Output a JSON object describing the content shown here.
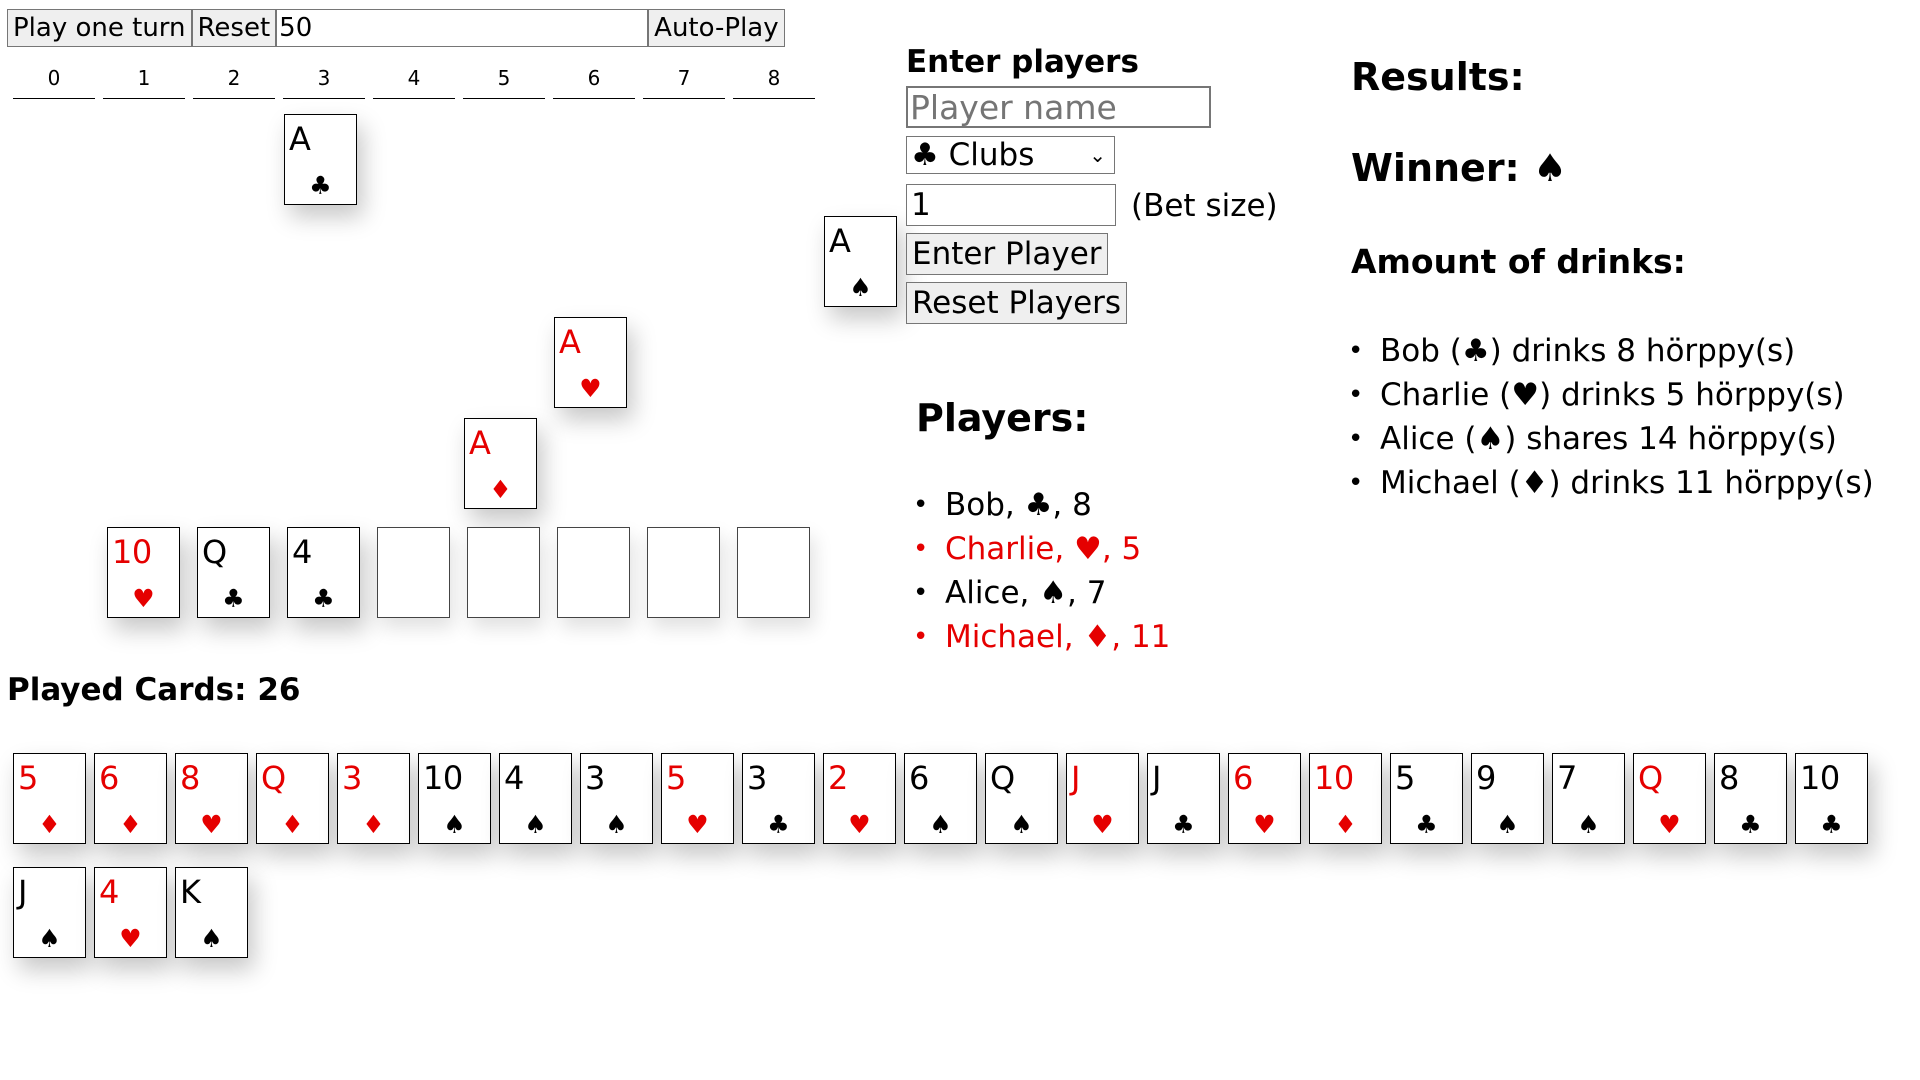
{
  "controls": {
    "play_one_turn": "Play one turn",
    "reset": "Reset",
    "turns_value": "50",
    "auto_play": "Auto-Play"
  },
  "columns": [
    "0",
    "1",
    "2",
    "3",
    "4",
    "5",
    "6",
    "7",
    "8"
  ],
  "board": {
    "aces": [
      {
        "rank": "A",
        "suit": "♣",
        "color": "black",
        "column": "3"
      },
      {
        "rank": "A",
        "suit": "♠",
        "color": "black",
        "column": "finish"
      },
      {
        "rank": "A",
        "suit": "♥",
        "color": "red",
        "column": "6"
      },
      {
        "rank": "A",
        "suit": "♦",
        "color": "red",
        "column": "5"
      }
    ],
    "bottom_row": [
      {
        "rank": "10",
        "suit": "♥",
        "color": "red"
      },
      {
        "rank": "Q",
        "suit": "♣",
        "color": "black"
      },
      {
        "rank": "4",
        "suit": "♣",
        "color": "black"
      },
      {
        "rank": "",
        "suit": "",
        "color": "black"
      },
      {
        "rank": "",
        "suit": "",
        "color": "black"
      },
      {
        "rank": "",
        "suit": "",
        "color": "black"
      },
      {
        "rank": "",
        "suit": "",
        "color": "black"
      },
      {
        "rank": "",
        "suit": "",
        "color": "black"
      }
    ]
  },
  "played": {
    "label": "Played Cards: 26",
    "cards": [
      {
        "rank": "5",
        "suit": "♦",
        "color": "red"
      },
      {
        "rank": "6",
        "suit": "♦",
        "color": "red"
      },
      {
        "rank": "8",
        "suit": "♥",
        "color": "red"
      },
      {
        "rank": "Q",
        "suit": "♦",
        "color": "red"
      },
      {
        "rank": "3",
        "suit": "♦",
        "color": "red"
      },
      {
        "rank": "10",
        "suit": "♠",
        "color": "black"
      },
      {
        "rank": "4",
        "suit": "♠",
        "color": "black"
      },
      {
        "rank": "3",
        "suit": "♠",
        "color": "black"
      },
      {
        "rank": "5",
        "suit": "♥",
        "color": "red"
      },
      {
        "rank": "3",
        "suit": "♣",
        "color": "black"
      },
      {
        "rank": "2",
        "suit": "♥",
        "color": "red"
      },
      {
        "rank": "6",
        "suit": "♠",
        "color": "black"
      },
      {
        "rank": "Q",
        "suit": "♠",
        "color": "black"
      },
      {
        "rank": "J",
        "suit": "♥",
        "color": "red"
      },
      {
        "rank": "J",
        "suit": "♣",
        "color": "black"
      },
      {
        "rank": "6",
        "suit": "♥",
        "color": "red"
      },
      {
        "rank": "10",
        "suit": "♦",
        "color": "red"
      },
      {
        "rank": "5",
        "suit": "♣",
        "color": "black"
      },
      {
        "rank": "9",
        "suit": "♠",
        "color": "black"
      },
      {
        "rank": "7",
        "suit": "♠",
        "color": "black"
      },
      {
        "rank": "Q",
        "suit": "♥",
        "color": "red"
      },
      {
        "rank": "8",
        "suit": "♣",
        "color": "black"
      },
      {
        "rank": "10",
        "suit": "♣",
        "color": "black"
      },
      {
        "rank": "J",
        "suit": "♠",
        "color": "black"
      },
      {
        "rank": "4",
        "suit": "♥",
        "color": "red"
      },
      {
        "rank": "K",
        "suit": "♠",
        "color": "black"
      }
    ]
  },
  "enter_players": {
    "title": "Enter players",
    "name_placeholder": "Player name",
    "suit_selected": "♣ Clubs",
    "bet_value": "1",
    "bet_label": "(Bet size)",
    "enter_button": "Enter Player",
    "reset_button": "Reset Players"
  },
  "players": {
    "title": "Players:",
    "list": [
      {
        "text": "Bob, ♣, 8",
        "color": "black"
      },
      {
        "text": "Charlie, ♥, 5",
        "color": "red"
      },
      {
        "text": "Alice, ♠, 7",
        "color": "black"
      },
      {
        "text": "Michael, ♦, 11",
        "color": "red"
      }
    ]
  },
  "results": {
    "title": "Results:",
    "winner": "Winner: ♠",
    "drinks_title": "Amount of drinks:",
    "list": [
      "Bob (♣) drinks 8 hörppy(s)",
      "Charlie (♥) drinks 5 hörppy(s)",
      "Alice (♠) shares 14 hörppy(s)",
      "Michael (♦) drinks 11 hörppy(s)"
    ]
  },
  "colors": {
    "red": "#e50000",
    "black": "#000000"
  }
}
